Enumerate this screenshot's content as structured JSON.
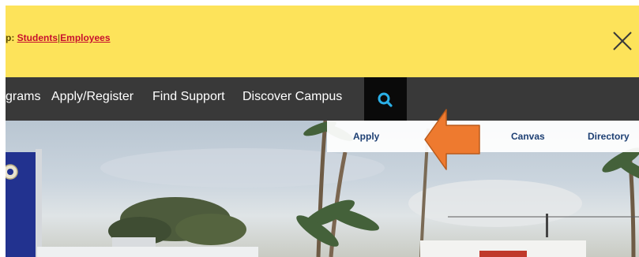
{
  "alert": {
    "prefix": "p: ",
    "links": [
      {
        "label": "Students"
      },
      {
        "label": "Employees"
      }
    ],
    "separator": "|"
  },
  "nav": {
    "items": [
      {
        "label": "grams"
      },
      {
        "label": "Apply/Register"
      },
      {
        "label": "Find Support"
      },
      {
        "label": "Discover Campus"
      }
    ]
  },
  "quick_links": {
    "items": [
      {
        "label": "Apply"
      },
      {
        "label": "Canvas"
      },
      {
        "label": "Directory"
      }
    ]
  },
  "colors": {
    "alert_bg": "#fde35a",
    "alert_link": "#c8102e",
    "nav_bg": "#393939",
    "search_bg": "#0a0a0a",
    "search_icon": "#2ab0e8",
    "quick_link_text": "#1d3f73",
    "annotation_arrow": "#ee7a2f"
  },
  "icons": {
    "close": "close-icon",
    "search": "search-icon",
    "arrow": "annotation-arrow-icon"
  }
}
